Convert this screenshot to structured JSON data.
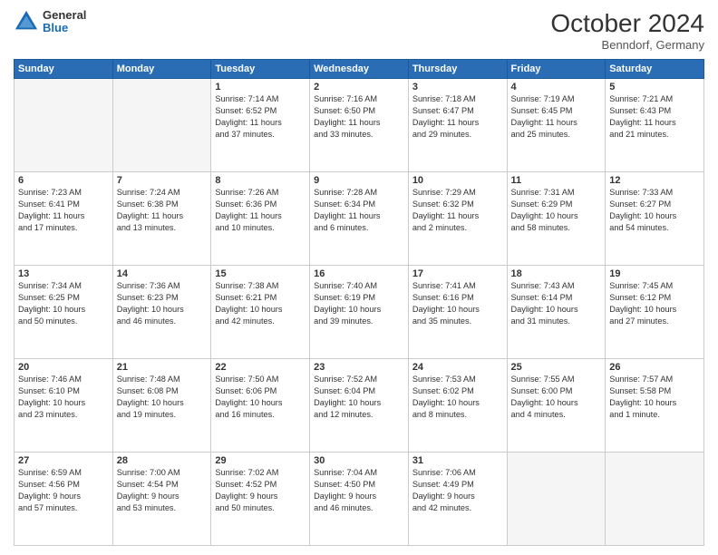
{
  "header": {
    "logo_general": "General",
    "logo_blue": "Blue",
    "month_title": "October 2024",
    "location": "Benndorf, Germany"
  },
  "weekdays": [
    "Sunday",
    "Monday",
    "Tuesday",
    "Wednesday",
    "Thursday",
    "Friday",
    "Saturday"
  ],
  "weeks": [
    [
      {
        "day": "",
        "info": ""
      },
      {
        "day": "",
        "info": ""
      },
      {
        "day": "1",
        "info": "Sunrise: 7:14 AM\nSunset: 6:52 PM\nDaylight: 11 hours\nand 37 minutes."
      },
      {
        "day": "2",
        "info": "Sunrise: 7:16 AM\nSunset: 6:50 PM\nDaylight: 11 hours\nand 33 minutes."
      },
      {
        "day": "3",
        "info": "Sunrise: 7:18 AM\nSunset: 6:47 PM\nDaylight: 11 hours\nand 29 minutes."
      },
      {
        "day": "4",
        "info": "Sunrise: 7:19 AM\nSunset: 6:45 PM\nDaylight: 11 hours\nand 25 minutes."
      },
      {
        "day": "5",
        "info": "Sunrise: 7:21 AM\nSunset: 6:43 PM\nDaylight: 11 hours\nand 21 minutes."
      }
    ],
    [
      {
        "day": "6",
        "info": "Sunrise: 7:23 AM\nSunset: 6:41 PM\nDaylight: 11 hours\nand 17 minutes."
      },
      {
        "day": "7",
        "info": "Sunrise: 7:24 AM\nSunset: 6:38 PM\nDaylight: 11 hours\nand 13 minutes."
      },
      {
        "day": "8",
        "info": "Sunrise: 7:26 AM\nSunset: 6:36 PM\nDaylight: 11 hours\nand 10 minutes."
      },
      {
        "day": "9",
        "info": "Sunrise: 7:28 AM\nSunset: 6:34 PM\nDaylight: 11 hours\nand 6 minutes."
      },
      {
        "day": "10",
        "info": "Sunrise: 7:29 AM\nSunset: 6:32 PM\nDaylight: 11 hours\nand 2 minutes."
      },
      {
        "day": "11",
        "info": "Sunrise: 7:31 AM\nSunset: 6:29 PM\nDaylight: 10 hours\nand 58 minutes."
      },
      {
        "day": "12",
        "info": "Sunrise: 7:33 AM\nSunset: 6:27 PM\nDaylight: 10 hours\nand 54 minutes."
      }
    ],
    [
      {
        "day": "13",
        "info": "Sunrise: 7:34 AM\nSunset: 6:25 PM\nDaylight: 10 hours\nand 50 minutes."
      },
      {
        "day": "14",
        "info": "Sunrise: 7:36 AM\nSunset: 6:23 PM\nDaylight: 10 hours\nand 46 minutes."
      },
      {
        "day": "15",
        "info": "Sunrise: 7:38 AM\nSunset: 6:21 PM\nDaylight: 10 hours\nand 42 minutes."
      },
      {
        "day": "16",
        "info": "Sunrise: 7:40 AM\nSunset: 6:19 PM\nDaylight: 10 hours\nand 39 minutes."
      },
      {
        "day": "17",
        "info": "Sunrise: 7:41 AM\nSunset: 6:16 PM\nDaylight: 10 hours\nand 35 minutes."
      },
      {
        "day": "18",
        "info": "Sunrise: 7:43 AM\nSunset: 6:14 PM\nDaylight: 10 hours\nand 31 minutes."
      },
      {
        "day": "19",
        "info": "Sunrise: 7:45 AM\nSunset: 6:12 PM\nDaylight: 10 hours\nand 27 minutes."
      }
    ],
    [
      {
        "day": "20",
        "info": "Sunrise: 7:46 AM\nSunset: 6:10 PM\nDaylight: 10 hours\nand 23 minutes."
      },
      {
        "day": "21",
        "info": "Sunrise: 7:48 AM\nSunset: 6:08 PM\nDaylight: 10 hours\nand 19 minutes."
      },
      {
        "day": "22",
        "info": "Sunrise: 7:50 AM\nSunset: 6:06 PM\nDaylight: 10 hours\nand 16 minutes."
      },
      {
        "day": "23",
        "info": "Sunrise: 7:52 AM\nSunset: 6:04 PM\nDaylight: 10 hours\nand 12 minutes."
      },
      {
        "day": "24",
        "info": "Sunrise: 7:53 AM\nSunset: 6:02 PM\nDaylight: 10 hours\nand 8 minutes."
      },
      {
        "day": "25",
        "info": "Sunrise: 7:55 AM\nSunset: 6:00 PM\nDaylight: 10 hours\nand 4 minutes."
      },
      {
        "day": "26",
        "info": "Sunrise: 7:57 AM\nSunset: 5:58 PM\nDaylight: 10 hours\nand 1 minute."
      }
    ],
    [
      {
        "day": "27",
        "info": "Sunrise: 6:59 AM\nSunset: 4:56 PM\nDaylight: 9 hours\nand 57 minutes."
      },
      {
        "day": "28",
        "info": "Sunrise: 7:00 AM\nSunset: 4:54 PM\nDaylight: 9 hours\nand 53 minutes."
      },
      {
        "day": "29",
        "info": "Sunrise: 7:02 AM\nSunset: 4:52 PM\nDaylight: 9 hours\nand 50 minutes."
      },
      {
        "day": "30",
        "info": "Sunrise: 7:04 AM\nSunset: 4:50 PM\nDaylight: 9 hours\nand 46 minutes."
      },
      {
        "day": "31",
        "info": "Sunrise: 7:06 AM\nSunset: 4:49 PM\nDaylight: 9 hours\nand 42 minutes."
      },
      {
        "day": "",
        "info": ""
      },
      {
        "day": "",
        "info": ""
      }
    ]
  ]
}
